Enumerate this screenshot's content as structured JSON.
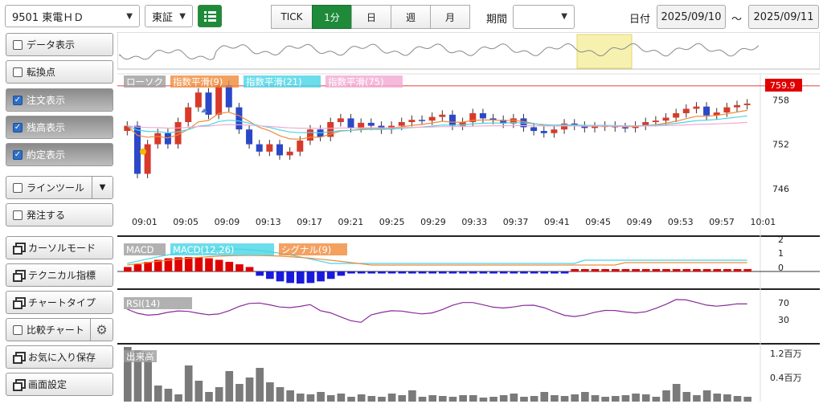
{
  "toolbar": {
    "symbol": "9501 東電ＨＤ",
    "market": "東証",
    "periods": [
      "TICK",
      "1分",
      "日",
      "週",
      "月"
    ],
    "active_period": "1分",
    "period_label": "期間",
    "period_value": "",
    "date_label": "日付",
    "date_from": "2025/09/10",
    "date_sep": "～",
    "date_to": "2025/09/11"
  },
  "sidebar": {
    "items": [
      {
        "label": "データ表示",
        "kind": "check",
        "checked": false
      },
      {
        "label": "転換点",
        "kind": "check",
        "checked": false
      },
      {
        "label": "注文表示",
        "kind": "check",
        "checked": true
      },
      {
        "label": "残高表示",
        "kind": "check",
        "checked": true
      },
      {
        "label": "約定表示",
        "kind": "check",
        "checked": true
      },
      {
        "label": "ラインツール",
        "kind": "check",
        "checked": false
      },
      {
        "label": "発注する",
        "kind": "check",
        "checked": false
      },
      {
        "label": "カーソルモード",
        "kind": "window"
      },
      {
        "label": "テクニカル指標",
        "kind": "window"
      },
      {
        "label": "チャートタイプ",
        "kind": "window"
      },
      {
        "label": "比較チャート",
        "kind": "check",
        "checked": false
      },
      {
        "label": "お気に入り保存",
        "kind": "window"
      },
      {
        "label": "画面設定",
        "kind": "window"
      }
    ]
  },
  "main_chart": {
    "legend": [
      "ローソク",
      "指数平滑(9)",
      "指数平滑(21)",
      "指数平滑(75)"
    ],
    "legend_colors": [
      "#9e9e9e",
      "#f08a3a",
      "#46d4e6",
      "#f3a9d2"
    ],
    "current_price": "759.9",
    "y_ticks": [
      "758",
      "752",
      "746"
    ],
    "x_ticks": [
      "09:01",
      "09:05",
      "09:09",
      "09:13",
      "09:17",
      "09:21",
      "09:25",
      "09:29",
      "09:33",
      "09:37",
      "09:41",
      "09:45",
      "09:49",
      "09:53",
      "09:57",
      "10:01"
    ],
    "up_color": "#d83a2a",
    "down_color": "#2a48c8"
  },
  "macd": {
    "legend": [
      "MACD",
      "MACD(12,26)",
      "シグナル(9)"
    ],
    "y_ticks": [
      "2",
      "1",
      "0"
    ]
  },
  "rsi": {
    "legend": [
      "RSI(14)"
    ],
    "y_ticks": [
      "70",
      "30"
    ]
  },
  "volume": {
    "legend": [
      "出来高"
    ],
    "y_ticks": [
      "1.2百万",
      "0.4百万"
    ]
  }
}
